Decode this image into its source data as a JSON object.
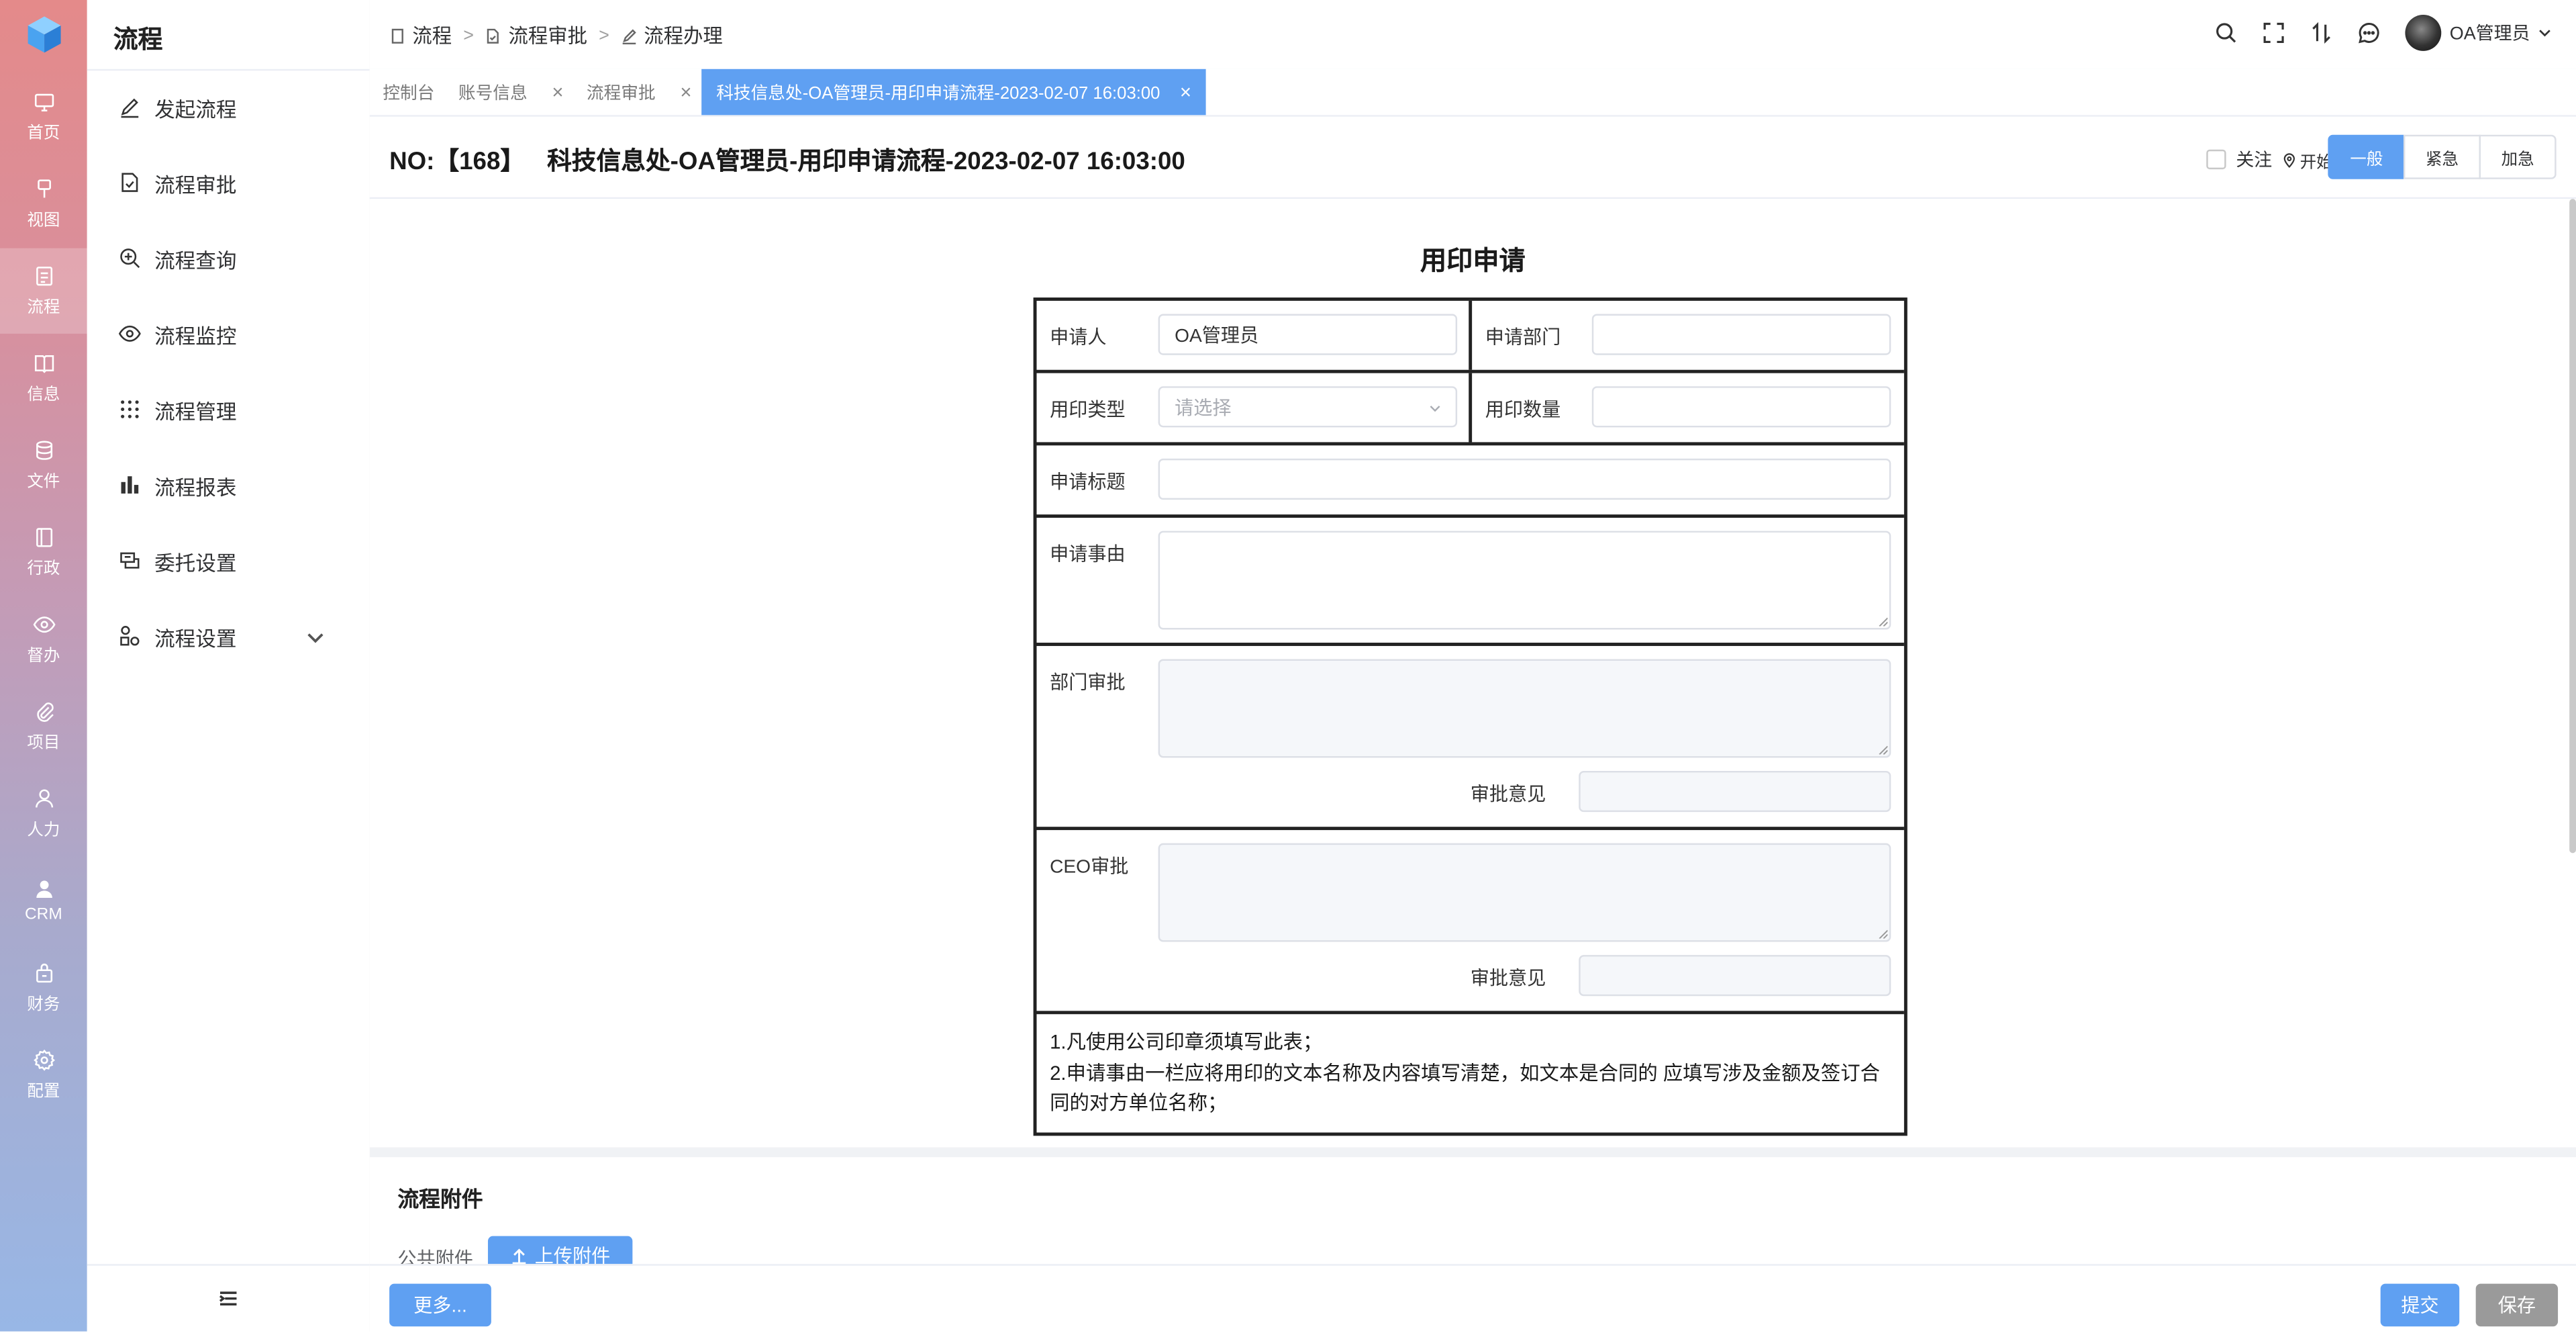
{
  "rail": {
    "items": [
      {
        "label": "首页",
        "icon": "monitor-icon"
      },
      {
        "label": "视图",
        "icon": "pin-icon"
      },
      {
        "label": "流程",
        "icon": "flow-doc-icon"
      },
      {
        "label": "信息",
        "icon": "book-icon"
      },
      {
        "label": "文件",
        "icon": "database-icon"
      },
      {
        "label": "行政",
        "icon": "notebook-icon"
      },
      {
        "label": "督办",
        "icon": "eye-icon"
      },
      {
        "label": "项目",
        "icon": "paperclip-icon"
      },
      {
        "label": "人力",
        "icon": "user-icon"
      },
      {
        "label": "CRM",
        "icon": "person-filled-icon"
      },
      {
        "label": "财务",
        "icon": "bag-icon"
      },
      {
        "label": "配置",
        "icon": "gear-icon"
      }
    ],
    "active_index": 2
  },
  "sidebar": {
    "title": "流程",
    "items": [
      {
        "label": "发起流程",
        "icon": "edit-icon"
      },
      {
        "label": "流程审批",
        "icon": "doc-check-icon"
      },
      {
        "label": "流程查询",
        "icon": "zoom-in-icon"
      },
      {
        "label": "流程监控",
        "icon": "eye-icon"
      },
      {
        "label": "流程管理",
        "icon": "grid-dots-icon"
      },
      {
        "label": "流程报表",
        "icon": "bar-chart-icon"
      },
      {
        "label": "委托设置",
        "icon": "delegate-icon"
      },
      {
        "label": "流程设置",
        "icon": "settings-flow-icon"
      }
    ]
  },
  "header": {
    "breadcrumb": [
      "流程",
      "流程审批",
      "流程办理"
    ],
    "user_name": "OA管理员"
  },
  "tabs": [
    {
      "label": "控制台",
      "closable": false
    },
    {
      "label": "账号信息",
      "closable": true
    },
    {
      "label": "流程审批",
      "closable": true
    },
    {
      "label": "科技信息处-OA管理员-用印申请流程-2023-02-07 16:03:00",
      "closable": true
    }
  ],
  "tab_close_glyph": "×",
  "titlebar": {
    "no": "NO:【168】",
    "name": "科技信息处-OA管理员-用印申请流程-2023-02-07 16:03:00",
    "follow_label": "关注",
    "start_label": "开始",
    "priority": [
      "一般",
      "紧急",
      "加急"
    ],
    "priority_selected": "一般"
  },
  "form": {
    "title": "用印申请",
    "applicant_label": "申请人",
    "applicant_value": "OA管理员",
    "dept_label": "申请部门",
    "dept_value": "",
    "seal_type_label": "用印类型",
    "seal_type_placeholder": "请选择",
    "seal_qty_label": "用印数量",
    "seal_qty_value": "",
    "subject_label": "申请标题",
    "subject_value": "",
    "reason_label": "申请事由",
    "dept_approve_label": "部门审批",
    "ceo_approve_label": "CEO审批",
    "opinion_label": "审批意见",
    "notes": [
      "1.凡使用公司印章须填写此表；",
      "2.申请事由一栏应将用印的文本名称及内容填写清楚，如文本是合同的 应填写涉及金额及签订合同的对方单位名称；"
    ]
  },
  "attachments": {
    "title": "流程附件",
    "public_label": "公共附件",
    "upload_label": "上传附件"
  },
  "footer": {
    "more_label": "更多...",
    "submit_label": "提交",
    "save_label": "保存"
  },
  "colors": {
    "accent": "#5fa0f2",
    "save_button": "#9a9a9a",
    "rail_top": "#e48a8a",
    "rail_bottom": "#98b7e6"
  }
}
